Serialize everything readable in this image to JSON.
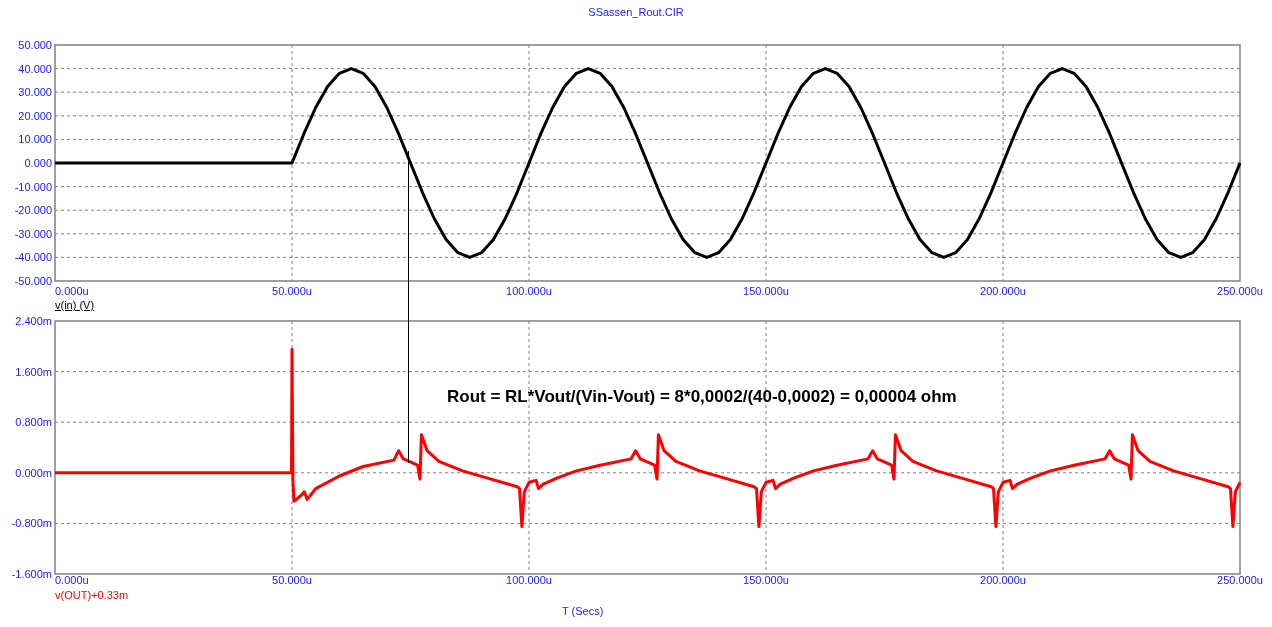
{
  "title": "SSassen_Rout.CIR",
  "charts": [
    {
      "legend": {
        "selected": true
      },
      "chart_data": {
        "type": "line",
        "grid": true,
        "xlim": [
          0,
          250
        ],
        "ylim": [
          -50,
          50
        ],
        "xticks": [
          {
            "value": 0,
            "label": "0.000u"
          },
          {
            "value": 50,
            "label": "50.000u"
          },
          {
            "value": 100,
            "label": "100.000u"
          },
          {
            "value": 150,
            "label": "150.000u"
          },
          {
            "value": 200,
            "label": "200.000u"
          },
          {
            "value": 250,
            "label": "250.000u"
          }
        ],
        "yticks": [
          {
            "value": 50,
            "label": "50.000"
          },
          {
            "value": 40,
            "label": "40.000"
          },
          {
            "value": 30,
            "label": "30.000"
          },
          {
            "value": 20,
            "label": "20.000"
          },
          {
            "value": 10,
            "label": "10.000"
          },
          {
            "value": 0,
            "label": "0.000"
          },
          {
            "value": -10,
            "label": "-10.000"
          },
          {
            "value": -20,
            "label": "-20.000"
          },
          {
            "value": -30,
            "label": "-30.000"
          },
          {
            "value": -40,
            "label": "-40.000"
          },
          {
            "value": -50,
            "label": "-50.000"
          }
        ],
        "x": [
          0,
          2.5,
          5,
          7.5,
          10,
          12.5,
          15,
          17.5,
          20,
          22.5,
          25,
          27.5,
          30,
          32.5,
          35,
          37.5,
          40,
          42.5,
          45,
          47.5,
          50,
          52.5,
          55,
          57.5,
          60,
          62.5,
          65,
          67.5,
          70,
          72.5,
          75,
          77.5,
          80,
          82.5,
          85,
          87.5,
          90,
          92.5,
          95,
          97.5,
          100,
          102.5,
          105,
          107.5,
          110,
          112.5,
          115,
          117.5,
          120,
          122.5,
          125,
          127.5,
          130,
          132.5,
          135,
          137.5,
          140,
          142.5,
          145,
          147.5,
          150,
          152.5,
          155,
          157.5,
          160,
          162.5,
          165,
          167.5,
          170,
          172.5,
          175,
          177.5,
          180,
          182.5,
          185,
          187.5,
          190,
          192.5,
          195,
          197.5,
          200,
          202.5,
          205,
          207.5,
          210,
          212.5,
          215,
          217.5,
          220,
          222.5,
          225,
          227.5,
          230,
          232.5,
          235,
          237.5,
          240,
          242.5,
          245,
          247.5,
          250
        ],
        "series": [
          {
            "name": "v(in) (V)",
            "color": "#000000",
            "values": [
              0,
              0,
              0,
              0,
              0,
              0,
              0,
              0,
              0,
              0,
              0,
              0,
              0,
              0,
              0,
              0,
              0,
              0,
              0,
              0,
              0,
              12.4,
              23.5,
              32.4,
              38,
              40,
              38,
              32.4,
              23.5,
              12.4,
              0,
              -12.4,
              -23.5,
              -32.4,
              -38,
              -40,
              -38,
              -32.4,
              -23.5,
              -12.4,
              0,
              12.4,
              23.5,
              32.4,
              38,
              40,
              38,
              32.4,
              23.5,
              12.4,
              0,
              -12.4,
              -23.5,
              -32.4,
              -38,
              -40,
              -38,
              -32.4,
              -23.5,
              -12.4,
              0,
              12.4,
              23.5,
              32.4,
              38,
              40,
              38,
              32.4,
              23.5,
              12.4,
              0,
              -12.4,
              -23.5,
              -32.4,
              -38,
              -40,
              -38,
              -32.4,
              -23.5,
              -12.4,
              0,
              12.4,
              23.5,
              32.4,
              38,
              40,
              38,
              32.4,
              23.5,
              12.4,
              0,
              -12.4,
              -23.5,
              -32.4,
              -38,
              -40,
              -38,
              -32.4,
              -23.5,
              -12.4,
              0
            ]
          }
        ]
      }
    },
    {
      "legend": {
        "selected": false
      },
      "chart_data": {
        "type": "line",
        "grid": true,
        "xlabel": "T (Secs)",
        "xlim": [
          0,
          250
        ],
        "ylim": [
          -1.6,
          2.4
        ],
        "xticks": [
          {
            "value": 0,
            "label": "0.000u"
          },
          {
            "value": 50,
            "label": "50.000u"
          },
          {
            "value": 100,
            "label": "100.000u"
          },
          {
            "value": 150,
            "label": "150.000u"
          },
          {
            "value": 200,
            "label": "200.000u"
          },
          {
            "value": 250,
            "label": "250.000u"
          }
        ],
        "yticks": [
          {
            "value": 2.4,
            "label": "2.400m"
          },
          {
            "value": 1.6,
            "label": "1.600m"
          },
          {
            "value": 0.8,
            "label": "0.800m"
          },
          {
            "value": 0,
            "label": "0.000m"
          },
          {
            "value": -0.8,
            "label": "-0.800m"
          },
          {
            "value": -1.6,
            "label": "-1.600m"
          }
        ],
        "x": [
          0,
          49.9,
          50,
          50.2,
          50.4,
          52,
          52.6,
          53.2,
          55,
          60,
          65,
          71.5,
          72.5,
          73.5,
          76.5,
          77,
          77.3,
          78.5,
          81,
          86,
          92,
          97.5,
          98,
          98.5,
          99,
          100,
          101.5,
          102,
          103,
          106,
          110,
          115,
          121.5,
          122.5,
          123.5,
          126.5,
          127,
          127.3,
          128.5,
          131,
          136,
          142,
          147.5,
          148,
          148.5,
          149,
          150,
          151.5,
          152,
          153,
          156,
          160,
          165,
          171.5,
          172.5,
          173.5,
          176.5,
          177,
          177.3,
          178.5,
          181,
          186,
          192,
          197.5,
          198,
          198.5,
          199,
          200,
          201.5,
          202,
          203,
          206,
          210,
          215,
          221.5,
          222.5,
          223.5,
          226.5,
          227,
          227.3,
          228.5,
          231,
          236,
          242,
          247.5,
          248,
          248.5,
          249,
          250
        ],
        "series": [
          {
            "name": "v(OUT)+0.33m",
            "color": "#ff0000",
            "values": [
              0,
              0,
              1.95,
              -0.1,
              -0.45,
              -0.35,
              -0.3,
              -0.42,
              -0.25,
              -0.05,
              0.1,
              0.2,
              0.35,
              0.22,
              0.12,
              -0.1,
              0.6,
              0.35,
              0.18,
              0.03,
              -0.1,
              -0.22,
              -0.25,
              -0.85,
              -0.3,
              -0.15,
              -0.12,
              -0.25,
              -0.18,
              -0.08,
              0.03,
              0.12,
              0.22,
              0.35,
              0.22,
              0.12,
              -0.1,
              0.6,
              0.35,
              0.18,
              0.03,
              -0.1,
              -0.22,
              -0.25,
              -0.85,
              -0.3,
              -0.15,
              -0.12,
              -0.25,
              -0.18,
              -0.08,
              0.03,
              0.12,
              0.22,
              0.35,
              0.22,
              0.12,
              -0.1,
              0.6,
              0.35,
              0.18,
              0.03,
              -0.1,
              -0.22,
              -0.25,
              -0.85,
              -0.3,
              -0.15,
              -0.12,
              -0.25,
              -0.18,
              -0.08,
              0.03,
              0.12,
              0.22,
              0.35,
              0.22,
              0.12,
              -0.1,
              0.6,
              0.35,
              0.18,
              0.03,
              -0.1,
              -0.22,
              -0.25,
              -0.85,
              -0.3,
              -0.15
            ]
          }
        ],
        "annotations": [
          "Rout = RL*Vout/(Vin-Vout) = 8*0,0002/(40-0,0002) = 0,00004 ohm"
        ]
      }
    }
  ]
}
